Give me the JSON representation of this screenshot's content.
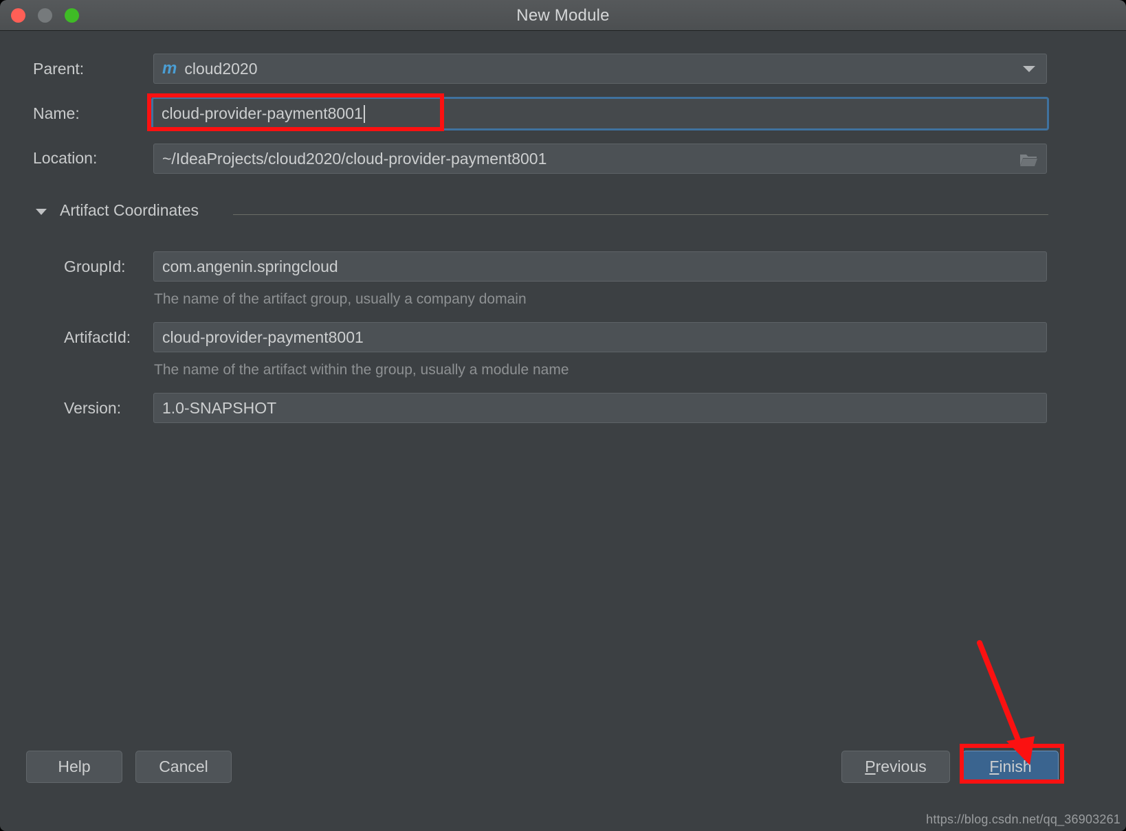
{
  "window": {
    "title": "New Module",
    "traffic_lights": [
      "close-button",
      "minimize-button",
      "maximize-button"
    ]
  },
  "form": {
    "parent": {
      "label": "Parent:",
      "value": "cloud2020",
      "icon": "maven-module-icon",
      "icon_glyph": "m",
      "dropdown_icon": "chevron-down-icon"
    },
    "name": {
      "label": "Name:",
      "value": "cloud-provider-payment8001",
      "focused": true
    },
    "location": {
      "label": "Location:",
      "value": "~/IdeaProjects/cloud2020/cloud-provider-payment8001",
      "browse_icon": "folder-icon"
    }
  },
  "artifact_section": {
    "title": "Artifact Coordinates",
    "expanded": true,
    "collapse_icon": "triangle-down-icon",
    "fields": {
      "group_id": {
        "label": "GroupId:",
        "value": "com.angenin.springcloud",
        "hint": "The name of the artifact group, usually a company domain"
      },
      "artifact_id": {
        "label": "ArtifactId:",
        "value": "cloud-provider-payment8001",
        "hint": "The name of the artifact within the group, usually a module name"
      },
      "version": {
        "label": "Version:",
        "value": "1.0-SNAPSHOT"
      }
    }
  },
  "footer": {
    "help_label": "Help",
    "cancel_label": "Cancel",
    "previous_mnemonic": "P",
    "previous_rest": "revious",
    "finish_mnemonic": "F",
    "finish_rest": "inish",
    "default_button": "finish-button"
  },
  "watermark": {
    "text": "https://blog.csdn.net/qq_36903261"
  },
  "annotations": {
    "color": "#fb1111",
    "boxes": [
      "name-field-highlight",
      "finish-button-highlight"
    ],
    "arrow": "red-arrow-pointing-to-finish"
  },
  "colors": {
    "dialog_background": "#3c4043",
    "titlebar_background": "#4e5153",
    "field_background": "#4c5155",
    "focus_ring": "#3f729f",
    "default_button": "#3a648f",
    "text_primary": "#cdcfd0",
    "text_hint": "#8e9193",
    "maven_icon": "#4a9ed4",
    "annotation_red": "#fb1111"
  }
}
